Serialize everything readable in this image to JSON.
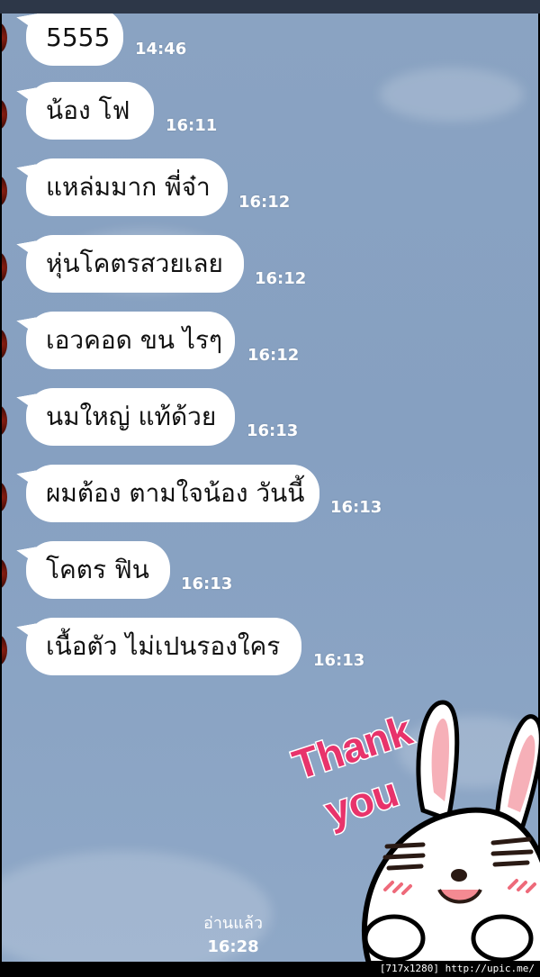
{
  "messages": [
    {
      "text": "5555",
      "time": "14:46"
    },
    {
      "text": "น้อง โฟ",
      "time": "16:11"
    },
    {
      "text": "แหล่มมาก พี่จ๋า",
      "time": "16:12"
    },
    {
      "text": "หุ่นโคตรสวยเลย",
      "time": "16:12"
    },
    {
      "text": "เอวคอด ขน ไรๆ",
      "time": "16:12"
    },
    {
      "text": "นมใหญ่ แท้ด้วย",
      "time": "16:13"
    },
    {
      "text": "ผมต้อง ตามใจน้อง วันนี้",
      "time": "16:13"
    },
    {
      "text": "โคตร ฟิน",
      "time": "16:13"
    },
    {
      "text": "เนื้อตัว ไม่เปนรองใคร",
      "time": "16:13"
    }
  ],
  "sticker": {
    "icon": "thank-you-rabbit-sticker",
    "text_line1": "Thank",
    "text_line2": "you"
  },
  "read_status": {
    "label": "อ่านแล้ว",
    "time": "16:28"
  },
  "watermark": "[717x1280] http://upic.me/",
  "colors": {
    "chat_background": "#86a0c1",
    "bubble": "#ffffff",
    "sticker_text": "#e8336b"
  }
}
